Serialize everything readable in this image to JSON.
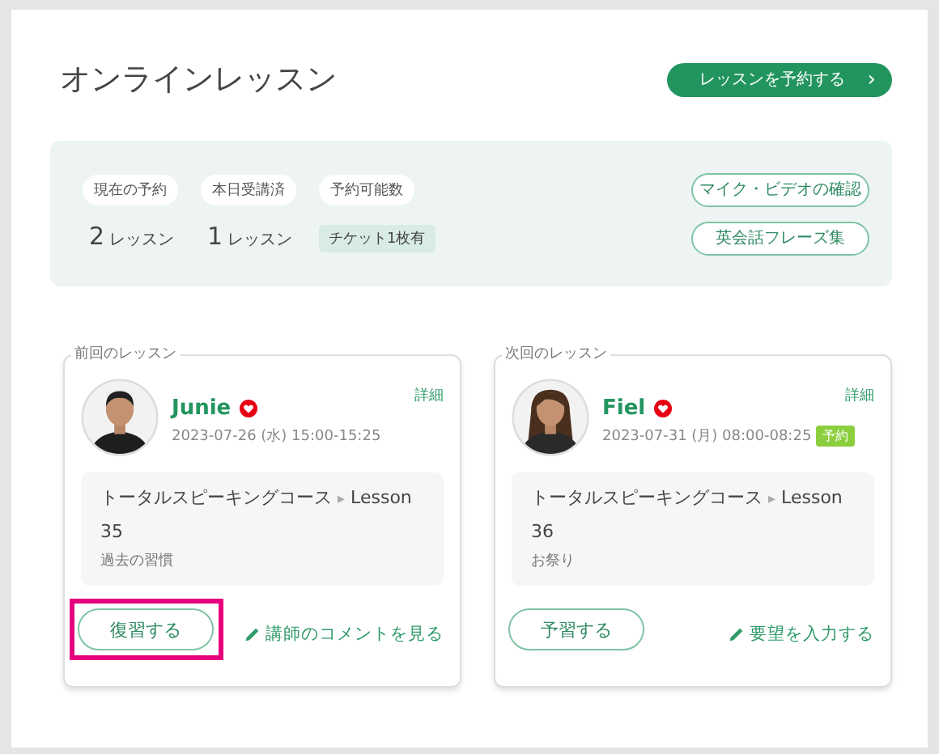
{
  "title": "オンラインレッスン",
  "book_button": {
    "label": "レッスンを予約する",
    "arrow": "›"
  },
  "stats": [
    {
      "label": "現在の予約",
      "kind": "count",
      "number": "2",
      "unit": "レッスン"
    },
    {
      "label": "本日受講済",
      "kind": "count",
      "number": "1",
      "unit": "レッスン"
    },
    {
      "label": "予約可能数",
      "kind": "tag",
      "value": "チケット1枚有"
    }
  ],
  "side_buttons": [
    "マイク・ビデオの確認",
    "英会話フレーズ集"
  ],
  "cards": [
    {
      "legend": "前回のレッスン",
      "detail": "詳細",
      "teacher": "Junie",
      "favorite": true,
      "datetime": "2023-07-26 (水) 15:00-15:25",
      "course": "トータルスピーキングコース",
      "arrow": "▸",
      "lesson": "Lesson 35",
      "topic": "過去の習慣",
      "action": "復習する",
      "action_highlighted": true,
      "link": "講師のコメントを見る"
    },
    {
      "legend": "次回のレッスン",
      "detail": "詳細",
      "teacher": "Fiel",
      "favorite": true,
      "datetime": "2023-07-31 (月) 08:00-08:25",
      "badge": "予約",
      "course": "トータルスピーキングコース",
      "arrow": "▸",
      "lesson": "Lesson 36",
      "topic": "お祭り",
      "action": "予習する",
      "action_highlighted": false,
      "link": "要望を入力する"
    }
  ]
}
